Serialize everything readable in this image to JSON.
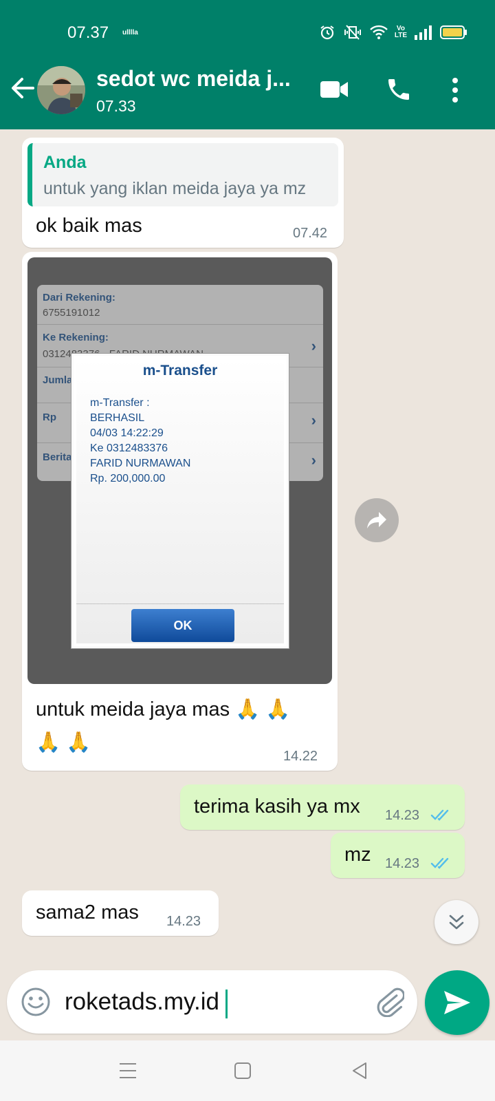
{
  "status_bar": {
    "time": "07.37",
    "carrier": "ulllla",
    "volte_top": "Vo",
    "volte_bottom": "LTE"
  },
  "header": {
    "contact_name": "sedot wc meida j...",
    "contact_status": "07.33"
  },
  "messages": [
    {
      "direction": "incoming",
      "quote_author": "Anda",
      "quote_text": "untuk yang iklan meida jaya ya mz",
      "text": "ok baik mas",
      "time": "07.42"
    },
    {
      "direction": "incoming",
      "image": {
        "bank_rows": [
          {
            "label": "Dari Rekening:",
            "value": "6755191012"
          },
          {
            "label": "Ke Rekening:",
            "value": "0312483376 - FARID NURMAWAN"
          },
          {
            "label": "Jumlah"
          },
          {
            "label": "Rp"
          },
          {
            "label": "Berita"
          }
        ],
        "dialog_title": "m-Transfer",
        "dialog_lines": [
          "m-Transfer :",
          "BERHASIL",
          "04/03 14:22:29",
          "Ke 0312483376",
          "FARID NURMAWAN",
          "Rp. 200,000.00"
        ],
        "dialog_button": "OK"
      },
      "text_line1": "untuk meida jaya mas 🙏 🙏",
      "text_line2": "🙏 🙏",
      "time": "14.22"
    },
    {
      "direction": "outgoing",
      "text": "terima kasih ya mx",
      "time": "14.23",
      "status": "read"
    },
    {
      "direction": "outgoing",
      "text": "mz",
      "time": "14.23",
      "status": "read"
    },
    {
      "direction": "incoming",
      "text": "sama2 mas",
      "time": "14.23"
    }
  ],
  "composer": {
    "value": "roketads.my.id"
  },
  "colors": {
    "header": "#008069",
    "accent": "#00a884",
    "outgoing_bubble": "#dcf8c6",
    "chat_background": "#ece5dd",
    "read_ticks": "#53bdeb"
  },
  "icons": [
    "back-arrow-icon",
    "video-call-icon",
    "phone-icon",
    "more-vert-icon",
    "forward-icon",
    "double-chevron-down-icon",
    "emoji-icon",
    "attach-icon",
    "send-icon",
    "read-ticks-icon",
    "recents-icon",
    "home-icon",
    "back-nav-icon"
  ]
}
